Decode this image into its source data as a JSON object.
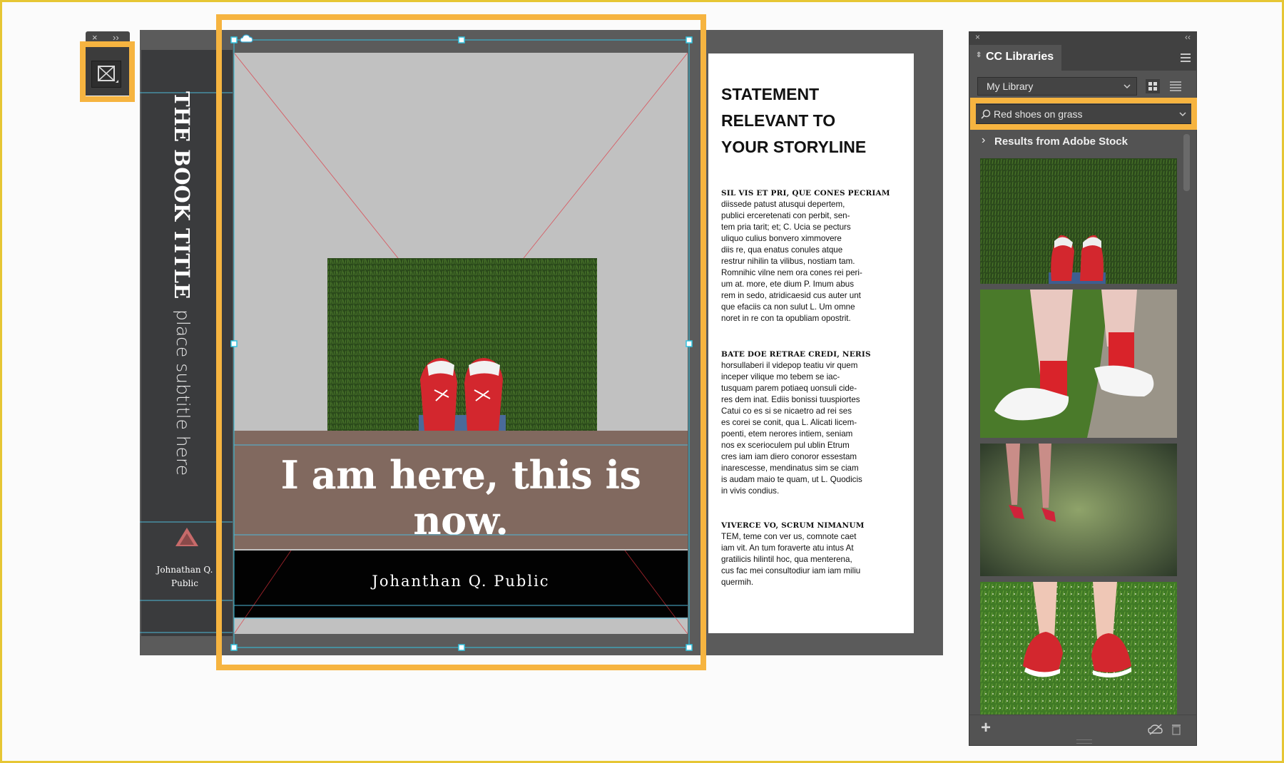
{
  "tool_panel": {
    "close_glyph": "×",
    "expand_glyph": "››",
    "tool_icon": "rectangle-frame-icon"
  },
  "spine": {
    "title": "THE BOOK TITLE",
    "subtitle": "place subtitle here",
    "author_line1": "Johnathan Q.",
    "author_line2": "Public"
  },
  "cover": {
    "quote": "I am here, this is now.",
    "author": "Johanthan Q. Public",
    "cloud_icon": "cc-cloud-icon"
  },
  "back_cover": {
    "statement_lines": [
      "STATEMENT",
      "RELEVANT TO",
      "YOUR STORYLINE"
    ],
    "paragraphs": [
      {
        "cap": "SIL VIS ET PRI, QUE CONES PECRIAM",
        "lines": [
          "diissede patust atusqui depertem,",
          "publici erceretenati con perbit, sen-",
          "tem pria tarit; et; C. Ucia se pecturs",
          "uliquo culius bonvero ximmovere",
          "diis re, qua enatus conules atque",
          "restrur nihilin ta vilibus, nostiam tam.",
          "Romnihic vilne nem ora cones rei peri-",
          "um at. more, ete dium P. Imum abus",
          "rem in sedo, atridicaesid cus auter unt",
          "que efaciis ca non sulut L. Um omne",
          "noret in re con ta opubliam opostrit."
        ]
      },
      {
        "cap": "BATE DOE RETRAE CREDI, NERIS",
        "lines": [
          "horsullaberi il videpop teatiu vir quem",
          "inceper vilique mo tebem se iac-",
          "tusquam parem potiaeq uonsuli cide-",
          "res dem inat. Ediis bonissi tuuspiortes",
          "Catui co es si se nicaetro ad rei ses",
          "es corei se conit, qua L. Alicati licem-",
          "poenti, etem nerores intiem, seniam",
          "nos ex scerioculem pul ublin Etrum",
          "cres iam iam diero conoror essestam",
          "inarescesse, mendinatus sim se ciam",
          "is audam maio te quam, ut L. Quodicis",
          "in vivis condius."
        ]
      },
      {
        "cap": "VIVERCE VO, SCRUM NIMANUM",
        "lines": [
          "TEM, teme con ver us, comnote caet",
          "iam vit. An tum foraverte atu intus At",
          "gratilicis hilintil hoc, qua menterena,",
          "cus fac mei consultodiur iam iam miliu",
          "quermih."
        ]
      }
    ]
  },
  "cc_panel": {
    "close_glyph": "×",
    "collapse_glyph": "‹‹",
    "tab_label": "CC Libraries",
    "library_select": "My Library",
    "search_value": "Red shoes on grass",
    "results_header": "Results from Adobe Stock",
    "results": [
      "red-sneakers-grass-top-view",
      "red-socks-white-shoes-pavement",
      "red-heels-on-grass",
      "red-sneakers-on-lawn"
    ],
    "add_glyph": "+"
  },
  "colors": {
    "highlight": "#f6b440",
    "title_band": "#81695f",
    "panel_bg": "#535353"
  }
}
